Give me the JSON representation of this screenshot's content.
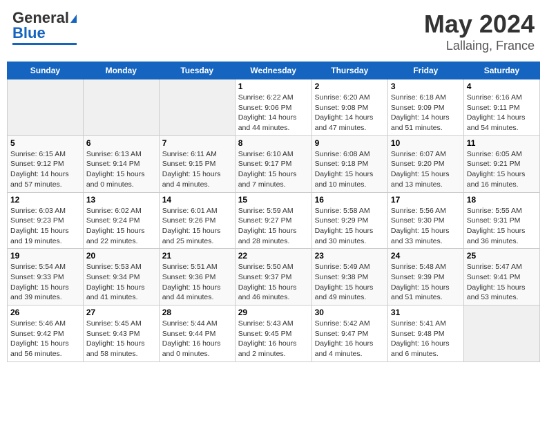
{
  "header": {
    "logo_line1": "General",
    "logo_line2": "Blue",
    "title": "May 2024",
    "subtitle": "Lallaing, France"
  },
  "days_of_week": [
    "Sunday",
    "Monday",
    "Tuesday",
    "Wednesday",
    "Thursday",
    "Friday",
    "Saturday"
  ],
  "weeks": [
    {
      "days": [
        {
          "date": "",
          "empty": true
        },
        {
          "date": "",
          "empty": true
        },
        {
          "date": "",
          "empty": true
        },
        {
          "date": "1",
          "sunrise": "6:22 AM",
          "sunset": "9:06 PM",
          "daylight": "14 hours and 44 minutes."
        },
        {
          "date": "2",
          "sunrise": "6:20 AM",
          "sunset": "9:08 PM",
          "daylight": "14 hours and 47 minutes."
        },
        {
          "date": "3",
          "sunrise": "6:18 AM",
          "sunset": "9:09 PM",
          "daylight": "14 hours and 51 minutes."
        },
        {
          "date": "4",
          "sunrise": "6:16 AM",
          "sunset": "9:11 PM",
          "daylight": "14 hours and 54 minutes."
        }
      ]
    },
    {
      "days": [
        {
          "date": "5",
          "sunrise": "6:15 AM",
          "sunset": "9:12 PM",
          "daylight": "14 hours and 57 minutes."
        },
        {
          "date": "6",
          "sunrise": "6:13 AM",
          "sunset": "9:14 PM",
          "daylight": "15 hours and 0 minutes."
        },
        {
          "date": "7",
          "sunrise": "6:11 AM",
          "sunset": "9:15 PM",
          "daylight": "15 hours and 4 minutes."
        },
        {
          "date": "8",
          "sunrise": "6:10 AM",
          "sunset": "9:17 PM",
          "daylight": "15 hours and 7 minutes."
        },
        {
          "date": "9",
          "sunrise": "6:08 AM",
          "sunset": "9:18 PM",
          "daylight": "15 hours and 10 minutes."
        },
        {
          "date": "10",
          "sunrise": "6:07 AM",
          "sunset": "9:20 PM",
          "daylight": "15 hours and 13 minutes."
        },
        {
          "date": "11",
          "sunrise": "6:05 AM",
          "sunset": "9:21 PM",
          "daylight": "15 hours and 16 minutes."
        }
      ]
    },
    {
      "days": [
        {
          "date": "12",
          "sunrise": "6:03 AM",
          "sunset": "9:23 PM",
          "daylight": "15 hours and 19 minutes."
        },
        {
          "date": "13",
          "sunrise": "6:02 AM",
          "sunset": "9:24 PM",
          "daylight": "15 hours and 22 minutes."
        },
        {
          "date": "14",
          "sunrise": "6:01 AM",
          "sunset": "9:26 PM",
          "daylight": "15 hours and 25 minutes."
        },
        {
          "date": "15",
          "sunrise": "5:59 AM",
          "sunset": "9:27 PM",
          "daylight": "15 hours and 28 minutes."
        },
        {
          "date": "16",
          "sunrise": "5:58 AM",
          "sunset": "9:29 PM",
          "daylight": "15 hours and 30 minutes."
        },
        {
          "date": "17",
          "sunrise": "5:56 AM",
          "sunset": "9:30 PM",
          "daylight": "15 hours and 33 minutes."
        },
        {
          "date": "18",
          "sunrise": "5:55 AM",
          "sunset": "9:31 PM",
          "daylight": "15 hours and 36 minutes."
        }
      ]
    },
    {
      "days": [
        {
          "date": "19",
          "sunrise": "5:54 AM",
          "sunset": "9:33 PM",
          "daylight": "15 hours and 39 minutes."
        },
        {
          "date": "20",
          "sunrise": "5:53 AM",
          "sunset": "9:34 PM",
          "daylight": "15 hours and 41 minutes."
        },
        {
          "date": "21",
          "sunrise": "5:51 AM",
          "sunset": "9:36 PM",
          "daylight": "15 hours and 44 minutes."
        },
        {
          "date": "22",
          "sunrise": "5:50 AM",
          "sunset": "9:37 PM",
          "daylight": "15 hours and 46 minutes."
        },
        {
          "date": "23",
          "sunrise": "5:49 AM",
          "sunset": "9:38 PM",
          "daylight": "15 hours and 49 minutes."
        },
        {
          "date": "24",
          "sunrise": "5:48 AM",
          "sunset": "9:39 PM",
          "daylight": "15 hours and 51 minutes."
        },
        {
          "date": "25",
          "sunrise": "5:47 AM",
          "sunset": "9:41 PM",
          "daylight": "15 hours and 53 minutes."
        }
      ]
    },
    {
      "days": [
        {
          "date": "26",
          "sunrise": "5:46 AM",
          "sunset": "9:42 PM",
          "daylight": "15 hours and 56 minutes."
        },
        {
          "date": "27",
          "sunrise": "5:45 AM",
          "sunset": "9:43 PM",
          "daylight": "15 hours and 58 minutes."
        },
        {
          "date": "28",
          "sunrise": "5:44 AM",
          "sunset": "9:44 PM",
          "daylight": "16 hours and 0 minutes."
        },
        {
          "date": "29",
          "sunrise": "5:43 AM",
          "sunset": "9:45 PM",
          "daylight": "16 hours and 2 minutes."
        },
        {
          "date": "30",
          "sunrise": "5:42 AM",
          "sunset": "9:47 PM",
          "daylight": "16 hours and 4 minutes."
        },
        {
          "date": "31",
          "sunrise": "5:41 AM",
          "sunset": "9:48 PM",
          "daylight": "16 hours and 6 minutes."
        },
        {
          "date": "",
          "empty": true
        }
      ]
    }
  ],
  "labels": {
    "sunrise": "Sunrise:",
    "sunset": "Sunset:",
    "daylight": "Daylight:"
  }
}
